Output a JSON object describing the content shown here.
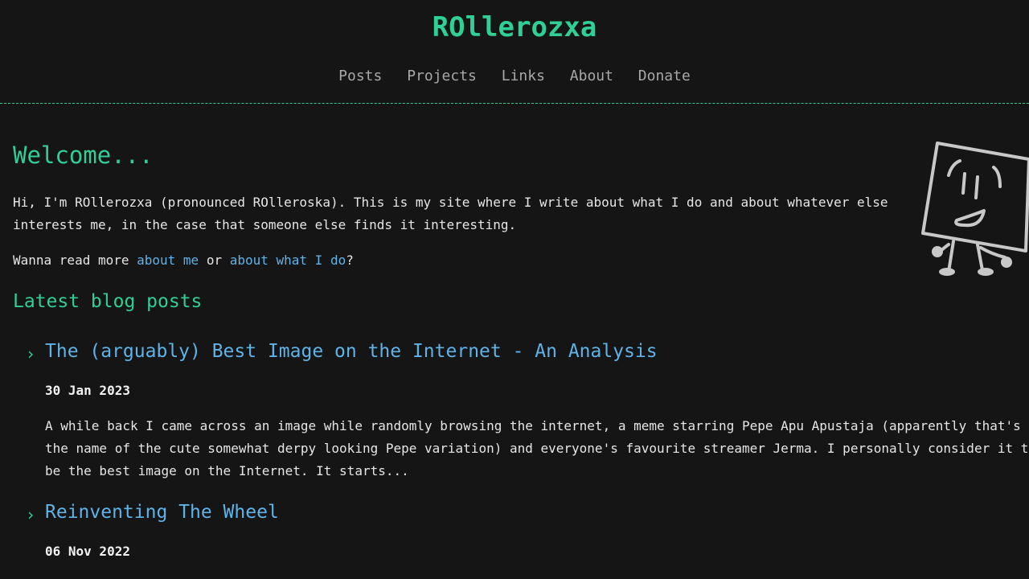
{
  "site": {
    "title": "ROllerozxa"
  },
  "nav": {
    "items": [
      "Posts",
      "Projects",
      "Links",
      "About",
      "Donate"
    ]
  },
  "welcome": {
    "heading": "Welcome...",
    "intro": "Hi, I'm ROllerozxa (pronounced ROlleroska). This is my site where I write about what I do and about whatever else interests me, in the case that someone else finds it interesting.",
    "readmore_prefix": "Wanna read more ",
    "link_about_me": "about me",
    "readmore_or": " or ",
    "link_about_what": "about what I do",
    "readmore_suffix": "?"
  },
  "latest": {
    "heading": "Latest blog posts"
  },
  "posts": [
    {
      "title": "The (arguably) Best Image on the Internet - An Analysis",
      "date": "30 Jan 2023",
      "excerpt": "A while back I came across an image while randomly browsing the internet, a meme starring Pepe Apu Apustaja (apparently that's the name of the cute somewhat derpy looking Pepe variation) and everyone's favourite streamer Jerma. I personally consider it to be the best image on the Internet. It starts..."
    },
    {
      "title": "Reinventing The Wheel",
      "date": "06 Nov 2022"
    }
  ],
  "colors": {
    "background": "#151515",
    "accent": "#2fcf95",
    "link": "#5fb3e8",
    "text": "#e6e6e6"
  },
  "icons": {
    "mascot": "square-character-drawing",
    "post_marker": "chevron-right-icon"
  }
}
